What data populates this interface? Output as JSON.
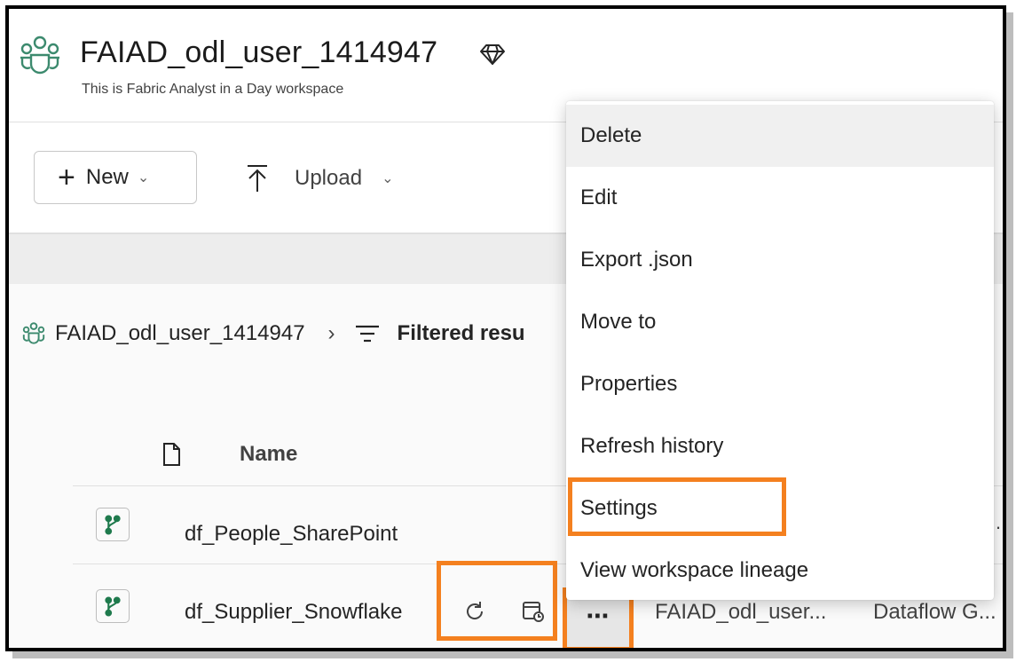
{
  "workspace": {
    "title": "FAIAD_odl_user_1414947",
    "description": "This is Fabric Analyst in a Day workspace",
    "icon": "workspace-people-icon",
    "badge_icon": "premium-diamond-icon"
  },
  "toolbar": {
    "new_label": "New",
    "upload_label": "Upload"
  },
  "breadcrumb": {
    "workspace": "FAIAD_odl_user_1414947",
    "filter_label": "Filtered resu"
  },
  "table": {
    "header_name": "Name",
    "rows": [
      {
        "name": "df_People_SharePoint",
        "location": "",
        "type": ""
      },
      {
        "name": "df_Supplier_Snowflake",
        "location": "FAIAD_odl_user...",
        "type": "Dataflow G..."
      }
    ]
  },
  "context_menu": {
    "items": [
      "Delete",
      "Edit",
      "Export .json",
      "Move to",
      "Properties",
      "Refresh history",
      "Settings",
      "View workspace lineage"
    ],
    "hovered_index": 0,
    "highlighted_index": 6
  },
  "colors": {
    "highlight": "#f4801f",
    "accent_green": "#1f7a4d",
    "workspace_icon": "#3c8a6e"
  }
}
